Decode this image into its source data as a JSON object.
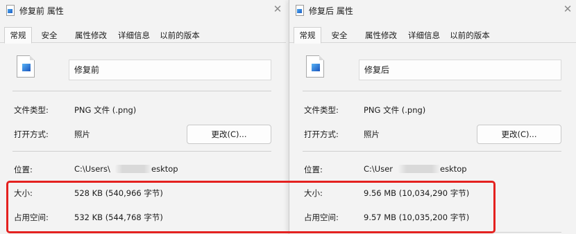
{
  "before": {
    "title": "修复前 属性",
    "close_glyph": "✕",
    "tabs": [
      "常规",
      "安全",
      "属性修改",
      "详细信息",
      "以前的版本"
    ],
    "file_name": "修复前",
    "labels": {
      "file_type": "文件类型:",
      "open_with": "打开方式:",
      "location": "位置:",
      "size": "大小:",
      "size_on_disk": "占用空间:"
    },
    "file_type": "PNG 文件 (.png)",
    "open_with": "照片",
    "change_button": "更改(C)...",
    "location_start": "C:\\Users\\",
    "location_end": "esktop",
    "size": "528 KB (540,966 字节)",
    "size_on_disk": "532 KB (544,768 字节)"
  },
  "after": {
    "title": "修复后 属性",
    "close_glyph": "✕",
    "tabs": [
      "常规",
      "安全",
      "属性修改",
      "详细信息",
      "以前的版本"
    ],
    "file_name": "修复后",
    "labels": {
      "file_type": "文件类型:",
      "open_with": "打开方式:",
      "location": "位置:",
      "size": "大小:",
      "size_on_disk": "占用空间:"
    },
    "file_type": "PNG 文件 (.png)",
    "open_with": "照片",
    "change_button": "更改(C)...",
    "location_start": "C:\\User",
    "location_end": "esktop",
    "size": "9.56 MB (10,034,290 字节)",
    "size_on_disk": "9.57 MB (10,035,200 字节)"
  },
  "colors": {
    "highlight": "#e4211f",
    "window_bg": "#f3f3f3"
  },
  "icons": {
    "file": "png-image-file-icon",
    "close": "close-icon"
  }
}
